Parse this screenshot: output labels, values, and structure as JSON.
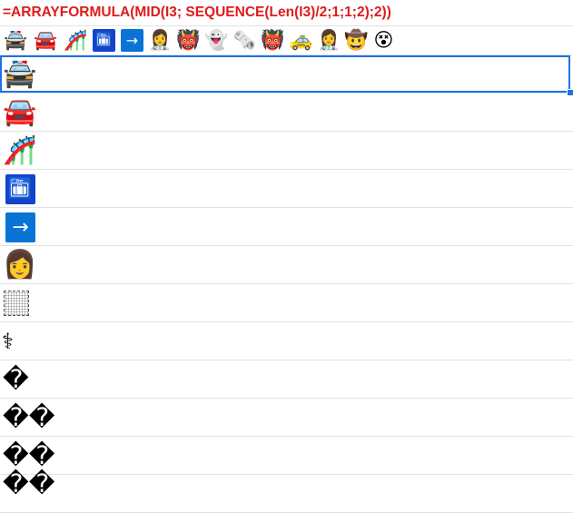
{
  "sheet": {
    "formula": "=ARRAYFORMULA(MID(I3; SEQUENCE(Len(I3)/2;1;1;2);2))",
    "emoji_strip": [
      {
        "glyph": "🚔",
        "icon": "police-car-icon"
      },
      {
        "glyph": "🚘",
        "icon": "car-icon"
      },
      {
        "glyph": "🎢",
        "icon": "roller-coaster-icon"
      },
      {
        "glyph": "🛅",
        "icon": "left-luggage-icon"
      },
      {
        "glyph": "→",
        "icon": "arrow-right-icon"
      },
      {
        "glyph": "👩‍⚕️",
        "icon": "health-worker-icon"
      },
      {
        "glyph": "👹",
        "icon": "ogre-icon"
      },
      {
        "glyph": "👻",
        "icon": "ghost-icon"
      },
      {
        "glyph": "🗞️",
        "icon": "newspaper-icon"
      },
      {
        "glyph": "👹",
        "icon": "ogre-icon"
      },
      {
        "glyph": "🚕",
        "icon": "taxi-icon"
      },
      {
        "glyph": "👩‍⚕️",
        "icon": "health-worker-icon"
      },
      {
        "glyph": "🤠",
        "icon": "cowboy-face-icon"
      },
      {
        "glyph": "😵",
        "icon": "dizzy-face-icon"
      }
    ],
    "cells": [
      {
        "glyph": "🚔",
        "icon": "police-car-icon"
      },
      {
        "glyph": "🚘",
        "icon": "car-icon"
      },
      {
        "glyph": "🎢",
        "icon": "roller-coaster-icon"
      },
      {
        "glyph": "🛅",
        "icon": "left-luggage-icon"
      },
      {
        "glyph": "→",
        "icon": "arrow-right-icon"
      },
      {
        "glyph": "👩",
        "icon": "woman-icon"
      },
      {
        "glyph": "",
        "icon": "dotted-placeholder-icon"
      },
      {
        "glyph": "⚕",
        "icon": "staff-of-aesculapius-icon"
      },
      {
        "glyph": "�",
        "icon": "replacement-char-icon"
      },
      {
        "glyph": "��",
        "icon": "replacement-char-icon"
      },
      {
        "glyph": "��",
        "icon": "replacement-char-icon"
      },
      {
        "glyph": "��",
        "icon": "replacement-char-icon"
      }
    ],
    "colors": {
      "formula_red": "#e01b1b",
      "selection_blue": "#1a73e8",
      "grid_line": "#e2e2e2"
    }
  }
}
